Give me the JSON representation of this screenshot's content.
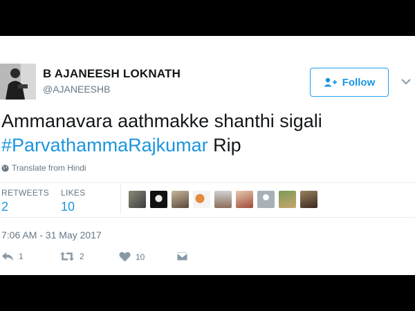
{
  "user": {
    "display_name": "B AJANEESH LOKNATH",
    "handle": "@AJANEESHB",
    "avatar_icon": "user-avatar"
  },
  "follow": {
    "label": "Follow",
    "icon": "follow-person-plus-icon"
  },
  "tweet": {
    "line1": "Ammanavara aathmakke shanthi sigali",
    "hashtag": "#ParvathammaRajkumar",
    "tail": " Rip"
  },
  "translate": {
    "label": "Translate from Hindi",
    "icon": "globe-icon"
  },
  "stats": {
    "retweets_label": "RETWEETS",
    "retweets_value": "2",
    "likes_label": "LIKES",
    "likes_value": "10"
  },
  "timestamp": "7:06 AM - 31 May 2017",
  "actions": {
    "reply_count": "1",
    "retweet_count": "2",
    "like_count": "10"
  },
  "colors": {
    "accent": "#1b95e0",
    "text": "#14171a",
    "muted": "#657786"
  }
}
